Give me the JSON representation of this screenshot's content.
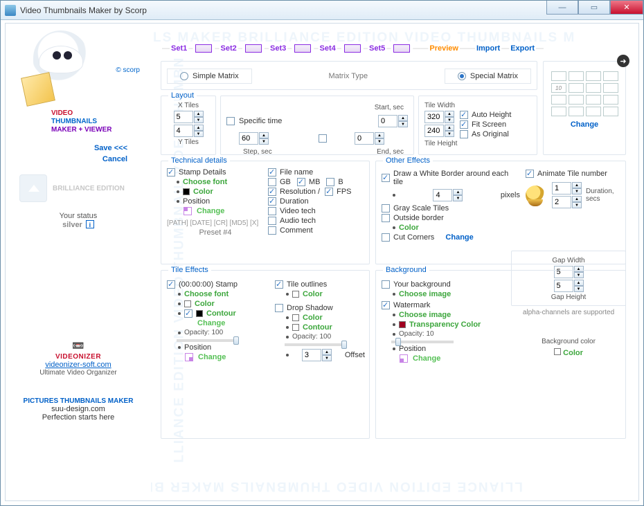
{
  "window": {
    "title": "Video Thumbnails Maker by Scorp"
  },
  "sidebar": {
    "scorp": "© scorp",
    "prod": {
      "l1": "VIDEO",
      "l2": "THUMBNAILS",
      "l3": "MAKER + VIEWER"
    },
    "save": "Save <<<",
    "cancel": "Cancel",
    "edition": "BRILLIANCE EDITION",
    "status_lbl": "Your status",
    "status_val": "silver",
    "promo1": {
      "title": "VIDEONIZER",
      "url": "videonizer-soft.com",
      "tag": "Ultimate Video Organizer"
    },
    "promo2": {
      "title": "PICTURES THUMBNAILS MAKER",
      "url": "suu-design.com",
      "tag": "Perfection starts here"
    }
  },
  "tabs": {
    "set1": "Set1",
    "set2": "Set2",
    "set3": "Set3",
    "set4": "Set4",
    "set5": "Set5",
    "preview": "Preview",
    "import": "Import",
    "export": "Export"
  },
  "matrix": {
    "simple": "Simple Matrix",
    "label": "Matrix Type",
    "special": "Special Matrix"
  },
  "preview": {
    "change": "Change",
    "slot": "10"
  },
  "layout": {
    "legend": "Layout",
    "xtiles": "X Tiles",
    "ytiles": "Y Tiles",
    "x": "5",
    "y": "4"
  },
  "time": {
    "specific": "Specific time",
    "step": "60",
    "step_lbl": "Step, sec",
    "start": "0",
    "start_lbl": "Start, sec",
    "end": "0",
    "end_lbl": "End, sec"
  },
  "tilew": {
    "legend_w": "Tile Width",
    "legend_h": "Tile Height",
    "w": "320",
    "h": "240",
    "auto": "Auto Height",
    "fit": "Fit Screen",
    "orig": "As Original"
  },
  "tech": {
    "legend": "Technical  details",
    "stamp": "Stamp Details",
    "choosefont": "Choose font",
    "color": "Color",
    "position": "Position",
    "change": "Change",
    "tags": "[PATH] [DATE] [CR] [MD5] [X]",
    "preset": "Preset #4",
    "filename": "File name",
    "gb": "GB",
    "mb": "MB",
    "b": "B",
    "res": "Resolution /",
    "fps": "FPS",
    "dur": "Duration",
    "vtech": "Video tech",
    "atech": "Audio tech",
    "comment": "Comment"
  },
  "other": {
    "legend": "Other Effects",
    "border": "Draw a White Border around each tile",
    "pixels": "pixels",
    "bval": "4",
    "gray": "Gray Scale Tiles",
    "outb": "Outside border",
    "color": "Color",
    "cut": "Cut Corners",
    "change": "Change",
    "anim": "Animate Tile number",
    "n": "1",
    "d": "2",
    "dur": "Duration, secs"
  },
  "gap": {
    "legend": "",
    "w": "5",
    "h": "5",
    "wl": "Gap Width",
    "hl": "Gap Height"
  },
  "alpha": "alpha-channels are supported",
  "tilefx": {
    "legend": "Tile Effects",
    "stamp": "(00:00:00) Stamp",
    "choosefont": "Choose font",
    "color": "Color",
    "contour": "Contour",
    "change": "Change",
    "opacity": "Opacity: 100",
    "position": "Position",
    "change2": "Change",
    "outlines": "Tile outlines",
    "tcolor": "Color",
    "dshadow": "Drop Shadow",
    "dcolor": "Color",
    "dcontour": "Contour",
    "dopacity": "Opacity: 100",
    "offset": "Offset",
    "offv": "3"
  },
  "bg": {
    "legend": "Background",
    "your": "Your background",
    "chooseimg": "Choose image",
    "wm": "Watermark",
    "wimg": "Choose image",
    "tcolor": "Transparency Color",
    "opacity": "Opacity: 10",
    "position": "Position",
    "change": "Change"
  },
  "bgcolor": {
    "lbl": "Background color",
    "color": "Color"
  }
}
